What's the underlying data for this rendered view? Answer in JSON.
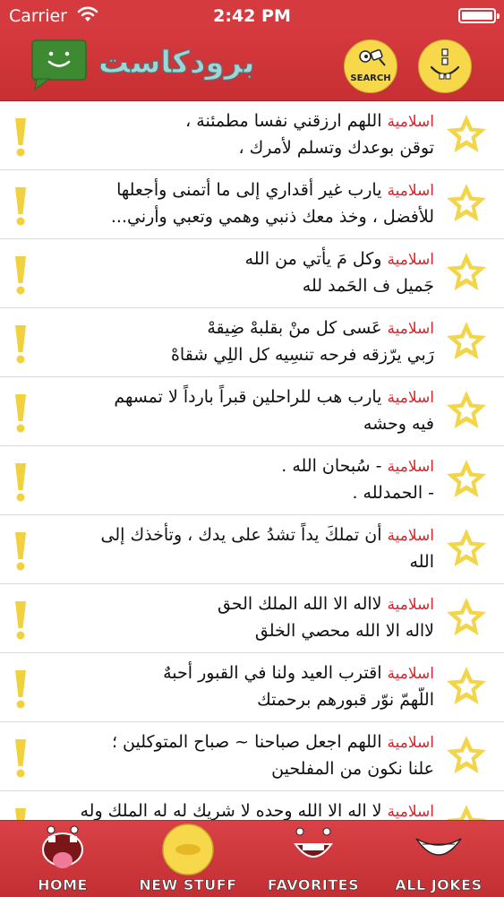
{
  "status_bar": {
    "carrier": "Carrier",
    "time": "2:42 PM"
  },
  "header": {
    "title": "برودكاست",
    "search_label": "SEARCH"
  },
  "messages": [
    {
      "category": "اسلامية",
      "line1": "اللهم ارزقني نفسا مطمئنة ،",
      "line2": "توقن بوعدك وتسلم لأمرك ،"
    },
    {
      "category": "اسلامية",
      "line1": "يارب غير أقداري إلى ما أتمنى وأجعلها",
      "line2": "للأفضل ، وخذ معك ذنبي وهمي وتعبي وأرني..."
    },
    {
      "category": "اسلامية",
      "line1": "وكل مَ يأتي من الله",
      "line2": "جَميل ف الحَمد لله"
    },
    {
      "category": "اسلامية",
      "line1": "عَسى كل منْ بقلبهْ ضِيقهْ",
      "line2": "رَبي يرّزقه فرحه تنسِيه كل اللِي شقاهْ"
    },
    {
      "category": "اسلامية",
      "line1": "يارب هب للراحلين قبراً بارداً لا تمسهم",
      "line2": "فيه وحشه"
    },
    {
      "category": "اسلامية",
      "line1": "- سُبحان الله .",
      "line2": "- الحمدلله ."
    },
    {
      "category": "اسلامية",
      "line1": "أن تملكَ يداً تشدُ على يدك ، وتأخذك إلى",
      "line2": "الله"
    },
    {
      "category": "اسلامية",
      "line1": "لااله الا الله الملك الحق",
      "line2": "لااله الا الله محصي الخلق"
    },
    {
      "category": "اسلامية",
      "line1": "اقترب العيد ولنا في القبور أحبهٌ",
      "line2": "اللّهمّ نوّر قبورهم برحمتك"
    },
    {
      "category": "اسلامية",
      "line1": "اللهم اجعل صباحنا ~ صباح المتوكلين ؛",
      "line2": "علنا نكون من المفلحين"
    },
    {
      "category": "اسلامية",
      "line1": "لا اله الا الله وحده لا شريك له له الملك وله",
      "line2": ""
    }
  ],
  "tabs": [
    {
      "label": "HOME"
    },
    {
      "label": "NEW STUFF"
    },
    {
      "label": "FAVORITES"
    },
    {
      "label": "ALL JOKES"
    }
  ],
  "colors": {
    "accent": "#d53a3f",
    "category": "#d0282d",
    "star": "#f3d54a",
    "exclamation": "#f1d23e"
  }
}
